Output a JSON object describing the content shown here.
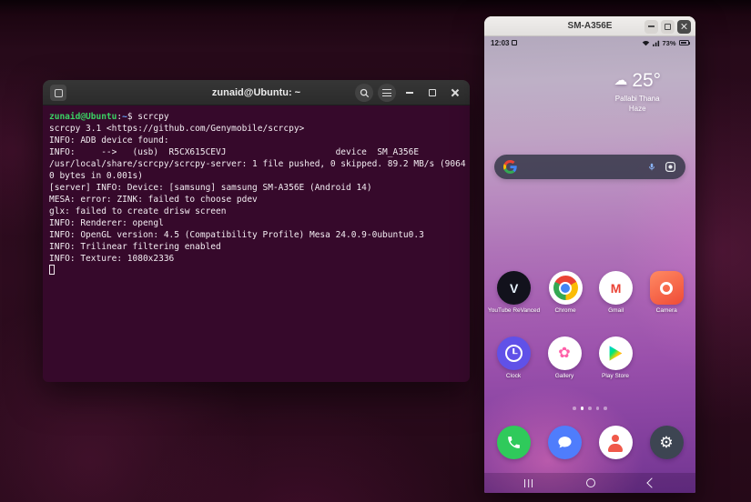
{
  "icons": {
    "cloud": "☁",
    "youtube_v": "V",
    "gmail_m": "M",
    "gallery_flower": "✿",
    "settings_gear": "⚙"
  },
  "terminal": {
    "titlebar": {
      "title": "zunaid@Ubuntu: ~"
    },
    "prompt": {
      "user": "zunaid@Ubuntu",
      "colon": ":",
      "path": "~",
      "dollar": "$",
      "command": "scrcpy"
    },
    "lines": [
      "scrcpy 3.1 <https://github.com/Genymobile/scrcpy>",
      "INFO: ADB device found:",
      "INFO:     -->   (usb)  R5CX615CEVJ                     device  SM_A356E",
      "/usr/local/share/scrcpy/scrcpy-server: 1 file pushed, 0 skipped. 89.2 MB/s (9064",
      "0 bytes in 0.001s)",
      "[server] INFO: Device: [samsung] samsung SM-A356E (Android 14)",
      "MESA: error: ZINK: failed to choose pdev",
      "glx: failed to create drisw screen",
      "INFO: Renderer: opengl",
      "INFO: OpenGL version: 4.5 (Compatibility Profile) Mesa 24.0.9-0ubuntu0.3",
      "INFO: Trilinear filtering enabled",
      "INFO: Texture: 1080x2336"
    ]
  },
  "scrcpy": {
    "titlebar": {
      "title": "SM-A356E"
    },
    "status": {
      "time": "12:03",
      "battery": "73%"
    },
    "weather": {
      "temp": "25°",
      "location": "Pallabi Thana",
      "condition": "Haze"
    },
    "apps": [
      {
        "label": "YouTube ReVanced",
        "icon": "youtube-revanced",
        "row": 1
      },
      {
        "label": "Chrome",
        "icon": "chrome",
        "row": 1
      },
      {
        "label": "Gmail",
        "icon": "gmail",
        "row": 1
      },
      {
        "label": "Camera",
        "icon": "camera",
        "row": 1
      },
      {
        "label": "Clock",
        "icon": "clock",
        "row": 2
      },
      {
        "label": "Gallery",
        "icon": "gallery",
        "row": 2
      },
      {
        "label": "Play Store",
        "icon": "play-store",
        "row": 2
      }
    ],
    "page_dots": {
      "count": 5,
      "active": 1
    },
    "dock": [
      {
        "label": "Phone",
        "icon": "phone"
      },
      {
        "label": "Messages",
        "icon": "messages"
      },
      {
        "label": "Contacts",
        "icon": "contacts"
      },
      {
        "label": "Settings",
        "icon": "settings"
      }
    ]
  }
}
